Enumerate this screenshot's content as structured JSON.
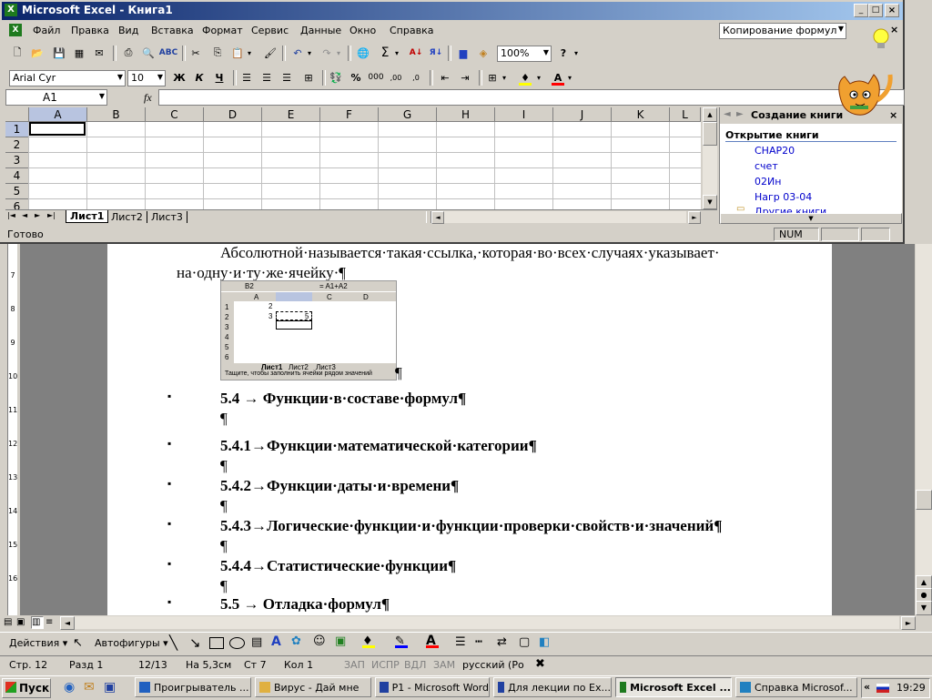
{
  "excel": {
    "title": "Microsoft Excel - Книга1",
    "menu": [
      "Файл",
      "Правка",
      "Вид",
      "Вставка",
      "Формат",
      "Сервис",
      "Данные",
      "Окно",
      "Справка"
    ],
    "help_box": "Копирование формул",
    "zoom": "100%",
    "font_name": "Arial Cyr",
    "font_size": "10",
    "bold": "Ж",
    "italic": "К",
    "underline": "Ч",
    "name_box": "A1",
    "fx": "fx",
    "columns": [
      "A",
      "B",
      "C",
      "D",
      "E",
      "F",
      "G",
      "H",
      "I",
      "J",
      "K",
      "L"
    ],
    "rows": [
      "1",
      "2",
      "3",
      "4",
      "5",
      "6"
    ],
    "sheets": [
      "Лист1",
      "Лист2",
      "Лист3"
    ],
    "status_ready": "Готово",
    "status_num": "NUM",
    "task_pane": {
      "title": "Создание книги",
      "section": "Открытие книги",
      "files": [
        "CHAP20",
        "счет",
        "02Ин",
        "Нагр 03-04"
      ],
      "more": "Другие книги..."
    }
  },
  "doc": {
    "para1_line1": "Абсолютной·называется·такая·ссылка,·которая·во·всех·случаях·указывает·",
    "para1_line2": "на·одну·и·ту·же·ячейку·¶",
    "after_image": "¶",
    "inset": {
      "name_box": "B2",
      "formula": "= A1+A2",
      "cols": [
        "A",
        "B",
        "C",
        "D"
      ],
      "rows": [
        "1",
        "2",
        "3",
        "4",
        "5",
        "6"
      ],
      "a1": "2",
      "a2": "3",
      "b2": "5",
      "sheets": [
        "Лист1",
        "Лист2",
        "Лист3"
      ],
      "status": "Тащите, чтобы заполнить ячейки рядом значений"
    },
    "items": [
      {
        "bullet": "▪",
        "text": "5.4 →  Функции·в·составе·формул¶",
        "after": "¶"
      },
      {
        "bullet": "▪",
        "text": "5.4.1→Функции·математической·категории¶",
        "after": "¶"
      },
      {
        "bullet": "▪",
        "text": "5.4.2→Функции·даты·и·времени¶",
        "after": "¶"
      },
      {
        "bullet": "▪",
        "text": "5.4.3→Логические·функции·и·функции·проверки·свойств·и·значений¶",
        "after": "¶"
      },
      {
        "bullet": "▪",
        "text": "5.4.4→Статистические·функции¶",
        "after": "¶"
      },
      {
        "bullet": "▪",
        "text": "5.5 →  Отладка·формул¶",
        "after": ""
      }
    ],
    "ruler": [
      "7",
      "8",
      "9",
      "10",
      "11",
      "12",
      "13",
      "14",
      "15",
      "16"
    ]
  },
  "drawing": {
    "actions": "Действия",
    "autoshapes": "Автофигуры"
  },
  "word_status": {
    "page": "Стр.  12",
    "section": "Разд  1",
    "pages": "12/13",
    "at": "На 5,3см",
    "line": "Ст  7",
    "col": "Кол  1",
    "rec": "ЗАП",
    "trk": "ИСПР",
    "ext": "ВДЛ",
    "ovr": "ЗАМ",
    "lang": "русский (Ро"
  },
  "taskbar": {
    "start": "Пуск",
    "items": [
      {
        "label": "Проигрыватель ...",
        "active": false
      },
      {
        "label": "Вирус - Дай мне",
        "active": false
      },
      {
        "label": "P1 - Microsoft Word",
        "active": false
      },
      {
        "label": "Для лекции по Ex...",
        "active": false
      },
      {
        "label": "Microsoft Excel ...",
        "active": true
      },
      {
        "label": "Справка Microsof...",
        "active": false
      }
    ],
    "lang": "«",
    "clock": "19:29"
  }
}
